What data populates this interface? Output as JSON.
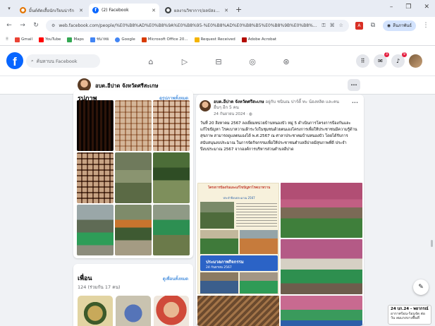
{
  "browser": {
    "tabs": [
      {
        "title": "มิ้นต์ตัดเสื้อนักเรียนน่ารัก",
        "active": false,
        "favicon_color": "#e37400"
      },
      {
        "title": "(2) Facebook",
        "active": true,
        "favicon_color": "#0866ff"
      },
      {
        "title": "ผลงานวิชาการ/อลบัสงานเด็กตามนยง",
        "active": false,
        "favicon_color": "#3c4043"
      }
    ],
    "new_tab": "+",
    "url": "web.facebook.com/people/%E0%B8%AD%E0%B8%9A%E0%B8%95-%E0%B8%AD%E0%B8%B5%E0%B8%9B%E0%B8%B2%E0%B8%87-%E0%B8%88%E0%B8%B1%E0%B8%87%E0%B8%AB%E0%B8%A7%E0%B8%B1%E0%B8%94%E0%B8%A8%E0%B8%A3%E0%B8%B5%E0%B8%AA%E0%B8%B0%E0%B9%80%E0%B8%81%E0%B8%A9/",
    "profile_label": "ลีนภาพันธ์",
    "bookmarks": [
      {
        "label": "Gmail",
        "color": "#ea4335"
      },
      {
        "label": "YouTube",
        "color": "#ff0000"
      },
      {
        "label": "Maps",
        "color": "#34a853"
      },
      {
        "label": "ชนาทย",
        "color": "#4285f4"
      },
      {
        "label": "Google",
        "color": "#4285f4"
      },
      {
        "label": "Microsoft Office 20...",
        "color": "#d83b01"
      },
      {
        "label": "Request Received",
        "color": "#f4b400"
      },
      {
        "label": "Adobe Acrobat",
        "color": "#b30b00"
      }
    ]
  },
  "facebook": {
    "search_placeholder": "ค้นหาบน Facebook",
    "badges": {
      "messenger": "3",
      "notifications": "9"
    },
    "profile_name": "อบต.อีปาด จังหวัดศรีสะเกษ",
    "photos": {
      "heading": "รูปภาพ",
      "link": "ดูรูปภาพทั้งหมด"
    },
    "friends": {
      "heading": "เพื่อน",
      "link": "ดูเพื่อนทั้งหมด",
      "count": "124 (ร่วมกัน 17 คน)"
    },
    "post": {
      "author": "อบต.อีปาด จังหวัดศรีสะเกษ",
      "header_rest": " อยู่กับ ชนินณ ปาร์ตี้ ทะ น้องหลิด และคนอื่นๆ อีก 5 คน",
      "date": "24 กันยายน 2024 · ",
      "text": "วันที่ 20 สิงหาคม 2567 ลงเยี่ยมหน่วยบ้านหนองบัว หมู่ 5 ดำเนินการโครงการป้องกันและแก้ไขปัญหา โรคเบาหวานเฝ้าระวังในชุมชนด้วยตนเองโครงการเพื่อให้ประชาชนมีความรู้ด้านสุขภาพ สามารถดูแลตนเองได้ พ.ศ.2567 ณ ศาลาประชาคมบ้านหนองบัว โดยได้รับการสนับสนุนงบประมาณ ในการจัดกิจกรรมเพื่อให้ประชาชนตำบลอีปาดมีสุขภาพที่ดี ประจำปีงบประมาณ 2567 จากองค์การบริหารส่วนตำบลอีปาด",
      "banner_title": "โครงการป้องกันและแก้ไขปัญหาโรคเบาหวาน",
      "banner_sub": "ประจำปีงบประมาณ 2567",
      "blue_label": "ประมวลภาพกิจกรรม",
      "blue_date": "24 กันยายน 2567"
    }
  },
  "toast": {
    "title": "24 บก.24 - พยากรณ์",
    "body": "อากาศร้อน-ร้อนจัด ต่อวัน ลมแรงบางพื้นที่"
  }
}
